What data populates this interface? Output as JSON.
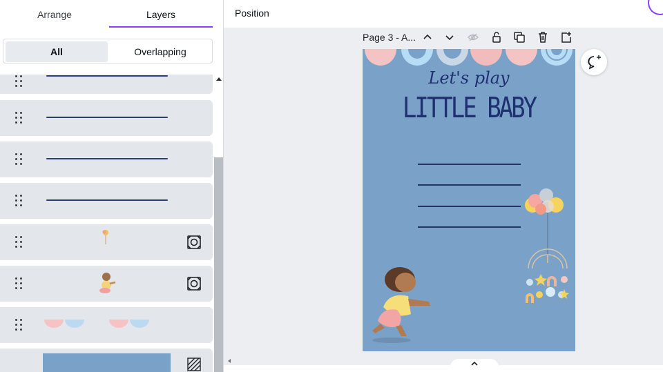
{
  "left_panel": {
    "tabs": [
      {
        "label": "Arrange",
        "active": false
      },
      {
        "label": "Layers",
        "active": true
      }
    ],
    "filter": {
      "all_label": "All",
      "overlapping_label": "Overlapping",
      "selected": "All"
    },
    "layers": [
      {
        "type": "line"
      },
      {
        "type": "line"
      },
      {
        "type": "line"
      },
      {
        "type": "line"
      },
      {
        "type": "graphic-balloon",
        "action_icon": "bg-remove-icon"
      },
      {
        "type": "graphic-baby",
        "action_icon": "bg-remove-icon"
      },
      {
        "type": "graphic-rainbow-arches"
      },
      {
        "type": "background-rectangle",
        "action_icon": "transparency-icon"
      }
    ]
  },
  "topbar": {
    "position_label": "Position"
  },
  "page_toolbar": {
    "page_label": "Page 3 - A...",
    "icons": [
      "chevron-up-icon",
      "chevron-down-icon",
      "hide-icon",
      "lock-icon",
      "duplicate-icon",
      "trash-icon",
      "add-page-icon"
    ]
  },
  "design": {
    "script_title": "Let's play",
    "main_title": "LITTLE BABY",
    "background_color": "#7aa2c9",
    "text_color": "#1f3070"
  },
  "colors": {
    "accent": "#8b3dff",
    "layer_bg": "#e3e6ea",
    "line_color": "#2d3d77"
  }
}
